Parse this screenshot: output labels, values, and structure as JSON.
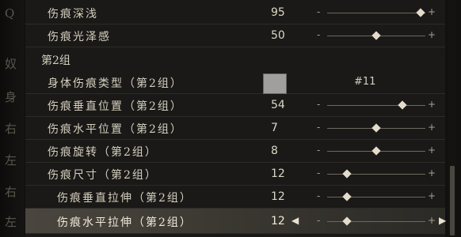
{
  "side_glyphs": [
    "Q",
    "奴",
    "身",
    "右",
    "左",
    "右",
    "左"
  ],
  "group2_header": "第2组",
  "rows": [
    {
      "label": "伤痕深浅",
      "value": "95",
      "level": 0.95
    },
    {
      "label": "伤痕光泽感",
      "value": "50",
      "level": 0.5
    },
    {
      "label": "身体伤痕类型（第2组）",
      "color_hex": "#11",
      "swatch_color": "#a19f9d"
    },
    {
      "label": "伤痕垂直位置（第2组）",
      "value": "54",
      "level": 0.77
    },
    {
      "label": "伤痕水平位置（第2组）",
      "value": "7",
      "level": 0.5
    },
    {
      "label": "伤痕旋转（第2组）",
      "value": "8",
      "level": 0.5
    },
    {
      "label": "伤痕尺寸（第2组）",
      "value": "12",
      "level": 0.2
    },
    {
      "label": "伤痕垂直拉伸（第2组）",
      "value": "12",
      "level": 0.2
    },
    {
      "label": "伤痕水平拉伸（第2组）",
      "value": "12",
      "level": 0.2
    }
  ],
  "slider_minus": "-",
  "slider_plus": "+",
  "arrow_left": "◀",
  "arrow_right": "▶"
}
